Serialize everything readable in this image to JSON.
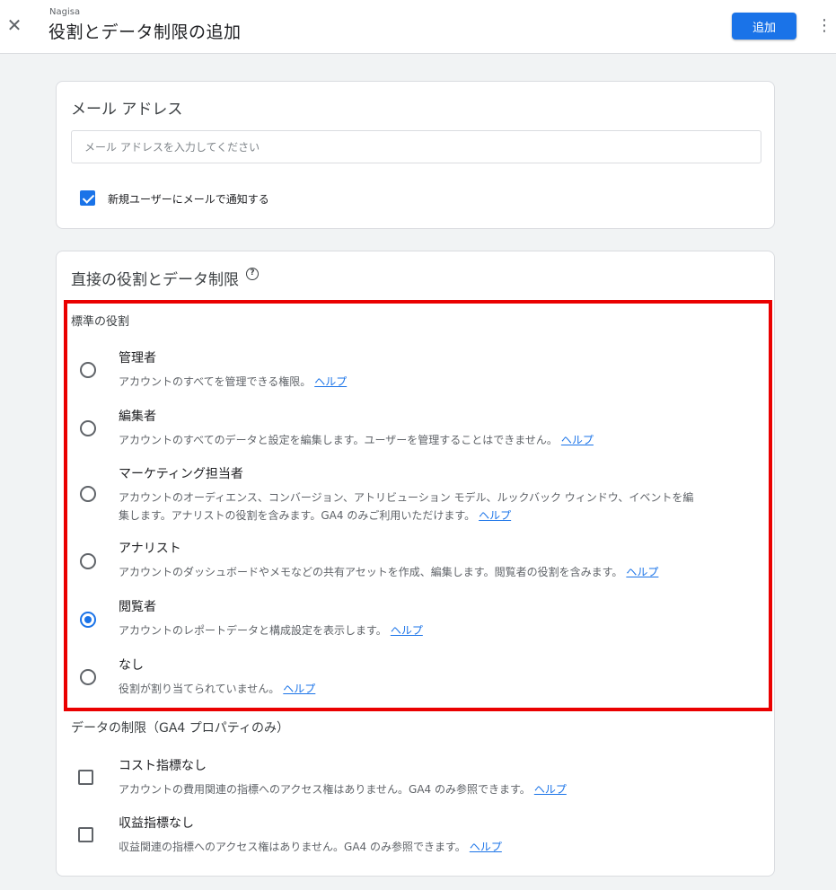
{
  "header": {
    "account_name": "Nagisa",
    "title": "役割とデータ制限の追加",
    "add_label": "追加"
  },
  "email_card": {
    "title": "メール アドレス",
    "input_placeholder": "メール アドレスを入力してください",
    "input_value": "",
    "notify_label": "新規ユーザーにメールで通知する",
    "notify_checked": true
  },
  "roles_card": {
    "title": "直接の役割とデータ制限",
    "standard_roles_label": "標準の役割",
    "help_link_label": "ヘルプ",
    "roles": [
      {
        "name": "管理者",
        "desc": "アカウントのすべてを管理できる権限。",
        "selected": false
      },
      {
        "name": "編集者",
        "desc": "アカウントのすべてのデータと設定を編集します。ユーザーを管理することはできません。",
        "selected": false
      },
      {
        "name": "マーケティング担当者",
        "desc_line1": "アカウントのオーディエンス、コンバージョン、アトリビューション モデル、ルックバック ウィンドウ、イベントを編",
        "desc_line2": "集します。アナリストの役割を含みます。GA4 のみご利用いただけます。",
        "selected": false
      },
      {
        "name": "アナリスト",
        "desc": "アカウントのダッシュボードやメモなどの共有アセットを作成、編集します。閲覧者の役割を含みます。",
        "selected": false
      },
      {
        "name": "閲覧者",
        "desc": "アカウントのレポートデータと構成設定を表示します。",
        "selected": true
      },
      {
        "name": "なし",
        "desc": "役割が割り当てられていません。",
        "selected": false
      }
    ],
    "data_restrictions_label": "データの制限（GA4 プロパティのみ）",
    "restrictions": [
      {
        "name": "コスト指標なし",
        "desc": "アカウントの費用関連の指標へのアクセス権はありません。GA4 のみ参照できます。",
        "checked": false
      },
      {
        "name": "収益指標なし",
        "desc": "収益関連の指標へのアクセス権はありません。GA4 のみ参照できます。",
        "checked": false
      }
    ]
  },
  "colors": {
    "accent": "#1a73e8",
    "highlight_border": "#ea0000"
  },
  "icons": {
    "close": "close-icon",
    "more": "more-vert-icon",
    "help": "help-outline-icon"
  }
}
